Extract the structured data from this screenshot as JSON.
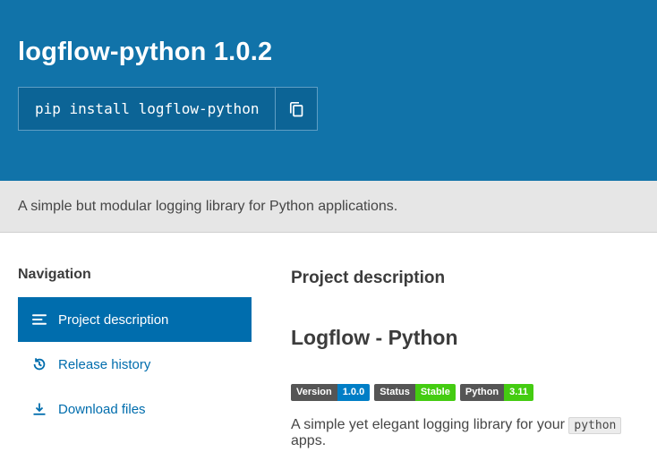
{
  "header": {
    "title": "logflow-python 1.0.2",
    "pip_command": "pip install logflow-python",
    "copy_icon": "copy-icon"
  },
  "summary": {
    "text": "A simple but modular logging library for Python applications."
  },
  "sidebar": {
    "title": "Navigation",
    "items": [
      {
        "label": "Project description",
        "icon": "align-left-icon",
        "active": true
      },
      {
        "label": "Release history",
        "icon": "history-icon",
        "active": false
      },
      {
        "label": "Download files",
        "icon": "download-icon",
        "active": false
      }
    ]
  },
  "main": {
    "section_title": "Project description",
    "heading": "Logflow - Python",
    "badges": [
      {
        "label": "Version",
        "value": "1.0.0",
        "value_color": "#007ec6"
      },
      {
        "label": "Status",
        "value": "Stable",
        "value_color": "#44cc11"
      },
      {
        "label": "Python",
        "value": "3.11",
        "value_color": "#44cc11"
      }
    ],
    "description": {
      "prefix": "A simple yet elegant logging library for your",
      "code": "python",
      "suffix": "apps."
    }
  },
  "colors": {
    "header_bg": "#1173a9",
    "brand_blue": "#006dad",
    "badge_label_bg": "#555555",
    "summary_bg": "#e6e6e6"
  }
}
